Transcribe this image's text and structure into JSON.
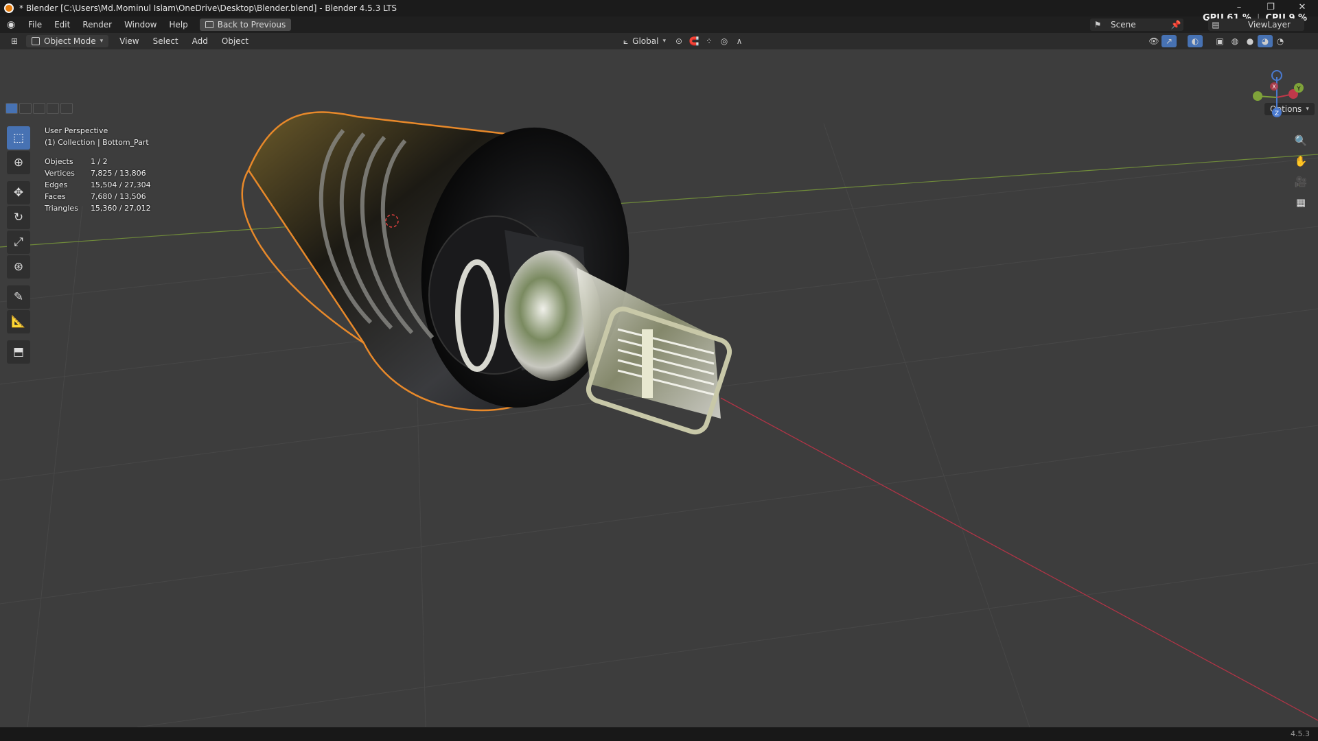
{
  "titlebar": {
    "title": "* Blender [C:\\Users\\Md.Mominul Islam\\OneDrive\\Desktop\\Blender.blend] - Blender 4.5.3 LTS",
    "minimize": "–",
    "restore": "❐",
    "close": "✕"
  },
  "menubar": {
    "items": [
      "File",
      "Edit",
      "Render",
      "Window",
      "Help"
    ],
    "back_button": "Back to Previous"
  },
  "performance": {
    "gpu": "GPU 61 %",
    "cpu": "CPU 9 %"
  },
  "scene": {
    "name": "Scene"
  },
  "view_layer": {
    "name": "ViewLayer"
  },
  "viewport_header": {
    "mode": "Object Mode",
    "menus": [
      "View",
      "Select",
      "Add",
      "Object"
    ],
    "orientation": "Global",
    "options": "Options"
  },
  "viewport_info": {
    "view": "User Perspective",
    "collection": "(1) Collection | Bottom_Part"
  },
  "stats": [
    {
      "label": "Objects",
      "value": "1 / 2"
    },
    {
      "label": "Vertices",
      "value": "7,825 / 13,806"
    },
    {
      "label": "Edges",
      "value": "15,504 / 27,304"
    },
    {
      "label": "Faces",
      "value": "7,680 / 13,506"
    },
    {
      "label": "Triangles",
      "value": "15,360 / 27,012"
    }
  ],
  "gizmo": {
    "x": "X",
    "y": "Y",
    "z": "Z"
  },
  "statusbar": {
    "version": "4.5.3"
  },
  "colors": {
    "selection_outline": "#e8892a",
    "x_axis": "#c0394a",
    "y_axis": "#7fa33a",
    "active_tool": "#4772b3"
  }
}
